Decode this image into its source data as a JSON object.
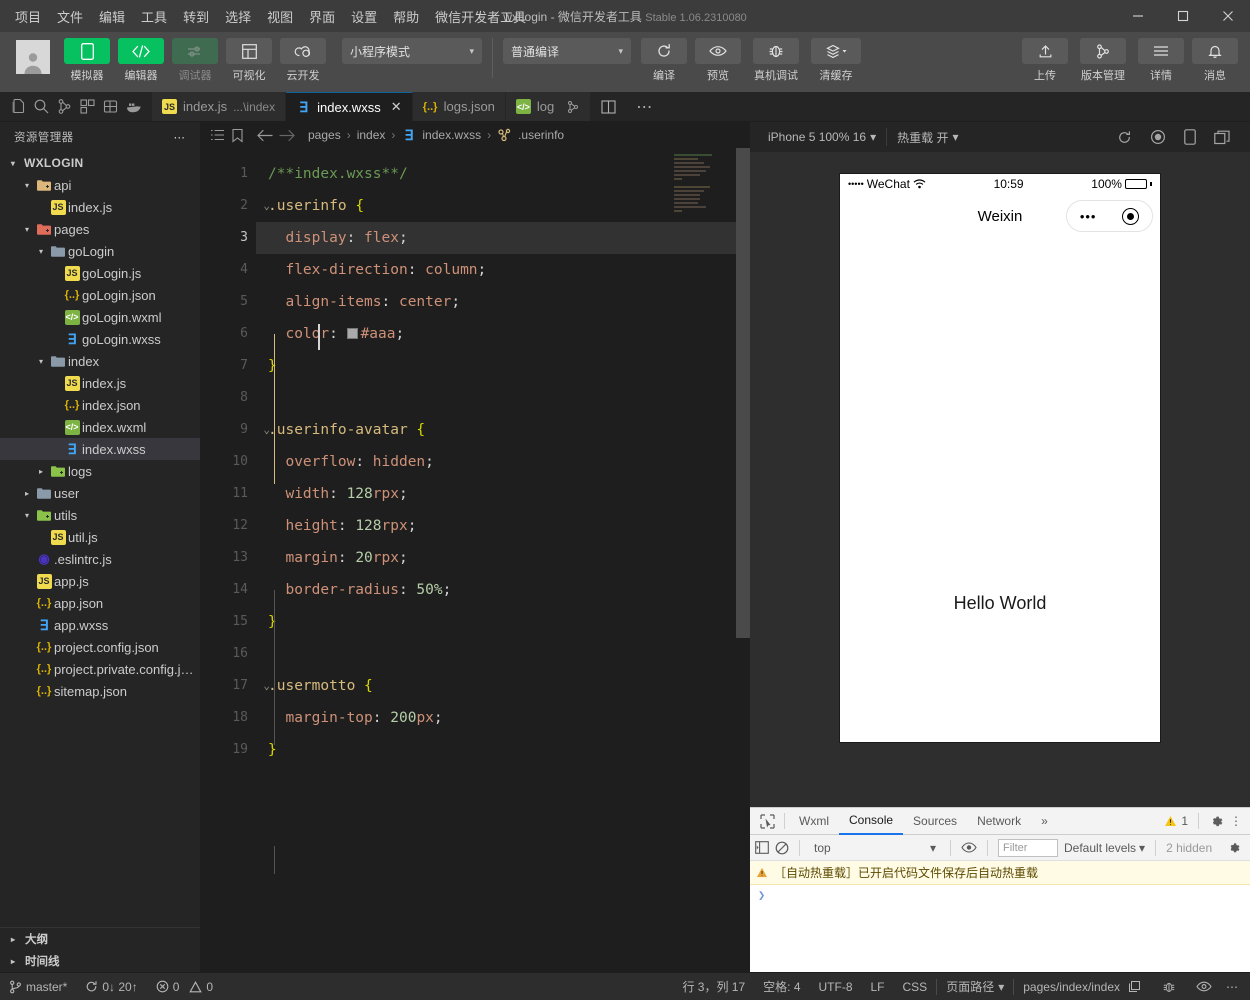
{
  "titlebar": {
    "menus": [
      "项目",
      "文件",
      "编辑",
      "工具",
      "转到",
      "选择",
      "视图",
      "界面",
      "设置",
      "帮助",
      "微信开发者工具"
    ],
    "project_name": "wxLogin",
    "dash": "-",
    "app_name": "微信开发者工具",
    "version": "Stable 1.06.2310080",
    "minimize": "−",
    "maximize": "▢",
    "close": "✕"
  },
  "toolbar": {
    "left_items": [
      {
        "label": "模拟器",
        "icon": "phone-icon",
        "state": "active"
      },
      {
        "label": "编辑器",
        "icon": "code-icon",
        "state": "active"
      },
      {
        "label": "调试器",
        "icon": "sliders-icon",
        "state": "disabled"
      },
      {
        "label": "可视化",
        "icon": "layout-icon",
        "state": "normal"
      },
      {
        "label": "云开发",
        "icon": "cloud-icon",
        "state": "normal"
      }
    ],
    "mode_select": "小程序模式",
    "compile_select": "普通编译",
    "mid_items": [
      {
        "label": "编译",
        "icon": "refresh-icon"
      },
      {
        "label": "预览",
        "icon": "eye-icon"
      },
      {
        "label": "真机调试",
        "icon": "bug-icon"
      },
      {
        "label": "清缓存",
        "icon": "layers-icon",
        "caret": "▾"
      }
    ],
    "right_items": [
      {
        "label": "上传",
        "icon": "upload-icon"
      },
      {
        "label": "版本管理",
        "icon": "branch-icon"
      },
      {
        "label": "详情",
        "icon": "menu-icon"
      },
      {
        "label": "消息",
        "icon": "bell-icon"
      }
    ]
  },
  "activitybar": {
    "icons": [
      "files-icon",
      "search-icon",
      "source-control-icon",
      "extensions-icon",
      "debug-icon",
      "docker-icon"
    ]
  },
  "tabs": [
    {
      "label": "index.js",
      "sub": "...\\index",
      "icon": "js-file-icon",
      "active": false,
      "closable": false
    },
    {
      "label": "index.wxss",
      "sub": "",
      "icon": "wxss-file-icon",
      "active": true,
      "closable": true,
      "close": "✕"
    },
    {
      "label": "logs.json",
      "sub": "",
      "icon": "json-file-icon",
      "active": false,
      "closable": false
    },
    {
      "label": "log",
      "sub": "",
      "icon": "wxml-file-icon",
      "active": false,
      "closable": false
    }
  ],
  "tab_actions": {
    "split": "split-editor-icon",
    "more": "⋯",
    "debug": "debug-alt-icon"
  },
  "sidebar": {
    "title": "资源管理器",
    "more": "⋯",
    "root": {
      "label": "WXLOGIN",
      "twisty": "▾"
    },
    "tree": [
      {
        "label": "api",
        "type": "folder-special",
        "depth": 1,
        "twisty": "▾",
        "color": "yellow"
      },
      {
        "label": "index.js",
        "type": "js",
        "depth": 2,
        "twisty": ""
      },
      {
        "label": "pages",
        "type": "folder-special",
        "depth": 1,
        "twisty": "▾",
        "color": "red"
      },
      {
        "label": "goLogin",
        "type": "folder",
        "depth": 2,
        "twisty": "▾",
        "color": "gray"
      },
      {
        "label": "goLogin.js",
        "type": "js",
        "depth": 3,
        "twisty": ""
      },
      {
        "label": "goLogin.json",
        "type": "json",
        "depth": 3,
        "twisty": ""
      },
      {
        "label": "goLogin.wxml",
        "type": "wxml",
        "depth": 3,
        "twisty": ""
      },
      {
        "label": "goLogin.wxss",
        "type": "wxss",
        "depth": 3,
        "twisty": ""
      },
      {
        "label": "index",
        "type": "folder",
        "depth": 2,
        "twisty": "▾",
        "color": "gray"
      },
      {
        "label": "index.js",
        "type": "js",
        "depth": 3,
        "twisty": ""
      },
      {
        "label": "index.json",
        "type": "json",
        "depth": 3,
        "twisty": ""
      },
      {
        "label": "index.wxml",
        "type": "wxml",
        "depth": 3,
        "twisty": ""
      },
      {
        "label": "index.wxss",
        "type": "wxss",
        "depth": 3,
        "twisty": "",
        "selected": true
      },
      {
        "label": "logs",
        "type": "folder-special",
        "depth": 2,
        "twisty": "▸",
        "color": "green"
      },
      {
        "label": "user",
        "type": "folder",
        "depth": 1,
        "twisty": "▸",
        "color": "gray"
      },
      {
        "label": "utils",
        "type": "folder-special",
        "depth": 1,
        "twisty": "▾",
        "color": "green"
      },
      {
        "label": "util.js",
        "type": "js",
        "depth": 2,
        "twisty": ""
      },
      {
        "label": ".eslintrc.js",
        "type": "eslint",
        "depth": 1,
        "twisty": ""
      },
      {
        "label": "app.js",
        "type": "js",
        "depth": 1,
        "twisty": ""
      },
      {
        "label": "app.json",
        "type": "json",
        "depth": 1,
        "twisty": ""
      },
      {
        "label": "app.wxss",
        "type": "wxss",
        "depth": 1,
        "twisty": ""
      },
      {
        "label": "project.config.json",
        "type": "json",
        "depth": 1,
        "twisty": ""
      },
      {
        "label": "project.private.config.js...",
        "type": "json",
        "depth": 1,
        "twisty": ""
      },
      {
        "label": "sitemap.json",
        "type": "json",
        "depth": 1,
        "twisty": ""
      }
    ],
    "sections": [
      {
        "label": "大纲",
        "twisty": "▸"
      },
      {
        "label": "时间线",
        "twisty": "▸"
      }
    ]
  },
  "breadcrumb": {
    "icons": [
      "outline-icon",
      "bookmark-icon",
      "back-arrow-icon",
      "forward-arrow-icon"
    ],
    "items": [
      "pages",
      "index",
      "index.wxss",
      ".userinfo"
    ],
    "separator": "›",
    "file_icon": "wxss-file-icon",
    "symbol_icon": "css-symbol-icon"
  },
  "editor": {
    "lines": [
      {
        "n": 1,
        "fold": "",
        "tokens": [
          {
            "t": "/**index.wxss**/",
            "c": "c-comment"
          }
        ]
      },
      {
        "n": 2,
        "fold": "⌄",
        "tokens": [
          {
            "t": ".userinfo ",
            "c": "c-sel"
          },
          {
            "t": "{",
            "c": "c-brace"
          }
        ]
      },
      {
        "n": 3,
        "fold": "",
        "current": true,
        "tokens": [
          {
            "t": "  display",
            "c": "c-prop"
          },
          {
            "t": ": ",
            "c": "c-punct"
          },
          {
            "t": "flex",
            "c": "c-val"
          },
          {
            "t": ";",
            "c": "c-punct"
          }
        ]
      },
      {
        "n": 4,
        "fold": "",
        "tokens": [
          {
            "t": "  flex-direction",
            "c": "c-prop"
          },
          {
            "t": ": ",
            "c": "c-punct"
          },
          {
            "t": "column",
            "c": "c-val"
          },
          {
            "t": ";",
            "c": "c-punct"
          }
        ]
      },
      {
        "n": 5,
        "fold": "",
        "tokens": [
          {
            "t": "  align-items",
            "c": "c-prop"
          },
          {
            "t": ": ",
            "c": "c-punct"
          },
          {
            "t": "center",
            "c": "c-val"
          },
          {
            "t": ";",
            "c": "c-punct"
          }
        ]
      },
      {
        "n": 6,
        "fold": "",
        "swatch": "#aaa",
        "tokens": [
          {
            "t": "  color",
            "c": "c-prop"
          },
          {
            "t": ": ",
            "c": "c-punct"
          },
          {
            "t": "#aaa",
            "c": "c-val"
          },
          {
            "t": ";",
            "c": "c-punct"
          }
        ]
      },
      {
        "n": 7,
        "fold": "",
        "tokens": [
          {
            "t": "}",
            "c": "c-brace"
          }
        ]
      },
      {
        "n": 8,
        "fold": "",
        "tokens": []
      },
      {
        "n": 9,
        "fold": "⌄",
        "tokens": [
          {
            "t": ".userinfo-avatar ",
            "c": "c-sel"
          },
          {
            "t": "{",
            "c": "c-brace"
          }
        ]
      },
      {
        "n": 10,
        "fold": "",
        "tokens": [
          {
            "t": "  overflow",
            "c": "c-prop"
          },
          {
            "t": ": ",
            "c": "c-punct"
          },
          {
            "t": "hidden",
            "c": "c-val"
          },
          {
            "t": ";",
            "c": "c-punct"
          }
        ]
      },
      {
        "n": 11,
        "fold": "",
        "tokens": [
          {
            "t": "  width",
            "c": "c-prop"
          },
          {
            "t": ": ",
            "c": "c-punct"
          },
          {
            "t": "128",
            "c": "c-num"
          },
          {
            "t": "rpx",
            "c": "c-val"
          },
          {
            "t": ";",
            "c": "c-punct"
          }
        ]
      },
      {
        "n": 12,
        "fold": "",
        "tokens": [
          {
            "t": "  height",
            "c": "c-prop"
          },
          {
            "t": ": ",
            "c": "c-punct"
          },
          {
            "t": "128",
            "c": "c-num"
          },
          {
            "t": "rpx",
            "c": "c-val"
          },
          {
            "t": ";",
            "c": "c-punct"
          }
        ]
      },
      {
        "n": 13,
        "fold": "",
        "tokens": [
          {
            "t": "  margin",
            "c": "c-prop"
          },
          {
            "t": ": ",
            "c": "c-punct"
          },
          {
            "t": "20",
            "c": "c-num"
          },
          {
            "t": "rpx",
            "c": "c-val"
          },
          {
            "t": ";",
            "c": "c-punct"
          }
        ]
      },
      {
        "n": 14,
        "fold": "",
        "tokens": [
          {
            "t": "  border-radius",
            "c": "c-prop"
          },
          {
            "t": ": ",
            "c": "c-punct"
          },
          {
            "t": "50%",
            "c": "c-num"
          },
          {
            "t": ";",
            "c": "c-punct"
          }
        ]
      },
      {
        "n": 15,
        "fold": "",
        "tokens": [
          {
            "t": "}",
            "c": "c-brace"
          }
        ]
      },
      {
        "n": 16,
        "fold": "",
        "tokens": []
      },
      {
        "n": 17,
        "fold": "⌄",
        "tokens": [
          {
            "t": ".usermotto ",
            "c": "c-sel"
          },
          {
            "t": "{",
            "c": "c-brace"
          }
        ]
      },
      {
        "n": 18,
        "fold": "",
        "tokens": [
          {
            "t": "  margin-top",
            "c": "c-prop"
          },
          {
            "t": ": ",
            "c": "c-punct"
          },
          {
            "t": "200",
            "c": "c-num"
          },
          {
            "t": "px",
            "c": "c-val"
          },
          {
            "t": ";",
            "c": "c-punct"
          }
        ]
      },
      {
        "n": 19,
        "fold": "",
        "tokens": [
          {
            "t": "}",
            "c": "c-brace"
          }
        ]
      }
    ]
  },
  "simulator": {
    "device": "iPhone 5 100% 16",
    "device_caret": "▾",
    "hot_reload": "热重载 开",
    "hot_caret": "▾",
    "icons": [
      "refresh-icon",
      "record-icon",
      "rotate-icon",
      "window-icon"
    ],
    "phone": {
      "carrier": "WeChat",
      "signal_dots": "•••••",
      "wifi_icon": "wifi-icon",
      "time": "10:59",
      "battery_pct": "100%",
      "nav_title": "Weixin",
      "capsule_dots": "•••",
      "capsule_target": "target-icon",
      "content": "Hello World"
    }
  },
  "devtools": {
    "inspect_icon": "inspect-icon",
    "tabs": [
      "Wxml",
      "Console",
      "Sources",
      "Network"
    ],
    "active_tab": "Console",
    "overflow": "»",
    "warning_count": "1",
    "warning_icon": "warning-icon",
    "settings_icon": "gear-icon",
    "more_icon": "⋮",
    "toolbar": {
      "sidebar_icon": "panel-icon",
      "clear_icon": "no-entry-icon",
      "context": "top",
      "context_caret": "▾",
      "eye_icon": "eye-icon",
      "filter_placeholder": "Filter",
      "levels": "Default levels",
      "levels_caret": "▾",
      "hidden": "2 hidden",
      "settings_icon": "gear-icon"
    },
    "messages": [
      {
        "type": "warning",
        "icon": "warning-icon",
        "text": "［自动热重载］已开启代码文件保存后自动热重载"
      }
    ],
    "prompt": "❯"
  },
  "statusbar": {
    "branch_icon": "branch-icon",
    "branch": "master*",
    "sync_icon": "sync-icon",
    "sync": "0↓ 20↑",
    "error_icon": "error-icon",
    "errors": "0",
    "warn_icon": "warning-triangle-icon",
    "warnings": "0",
    "cursor": "行 3，列 17",
    "spaces": "空格: 4",
    "encoding": "UTF-8",
    "eol": "LF",
    "language": "CSS",
    "page_path_label": "页面路径",
    "page_path_caret": "▾",
    "page_path": "pages/index/index",
    "copy_icon": "copy-icon",
    "right_icons": [
      "bug-icon",
      "eye-icon",
      "more-icon"
    ]
  }
}
